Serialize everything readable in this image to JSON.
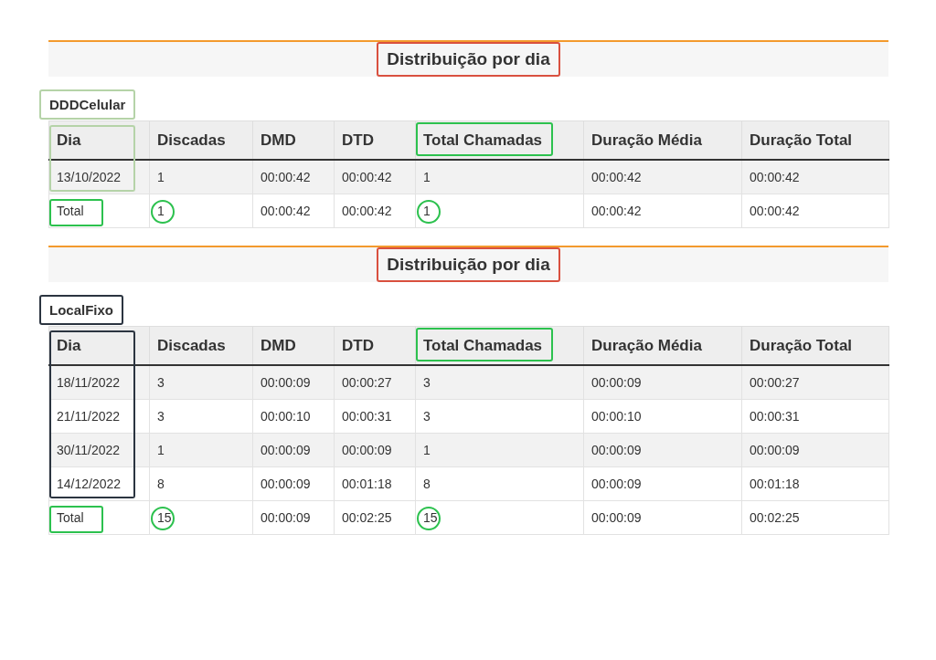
{
  "sections": [
    {
      "title": {
        "text": "Distribuição por dia",
        "color": "#d9503f"
      },
      "label": {
        "text": "DDDCelular",
        "color": "#b5d3a8"
      },
      "columns": [
        {
          "label": "Dia",
          "color": "#b5d3a8"
        },
        {
          "label": "Discadas"
        },
        {
          "label": "DMD"
        },
        {
          "label": "DTD"
        },
        {
          "label": "Total Chamadas",
          "color": "#2cc14e"
        },
        {
          "label": "Duração Média"
        },
        {
          "label": "Duração Total"
        }
      ],
      "rows": [
        [
          "13/10/2022",
          "1",
          "00:00:42",
          "00:00:42",
          "1",
          "00:00:42",
          "00:00:42"
        ]
      ],
      "total": [
        {
          "text": "Total",
          "kind": "box",
          "color": "#2cc14e"
        },
        {
          "text": "1",
          "kind": "circle",
          "color": "#2cc14e"
        },
        {
          "text": "00:00:42"
        },
        {
          "text": "00:00:42"
        },
        {
          "text": "1",
          "kind": "circle",
          "color": "#2cc14e"
        },
        {
          "text": "00:00:42"
        },
        {
          "text": "00:00:42"
        }
      ]
    },
    {
      "title": {
        "text": "Distribuição por dia",
        "color": "#d9503f"
      },
      "label": {
        "text": "LocalFixo",
        "color": "#2b3440"
      },
      "columns": [
        {
          "label": "Dia",
          "color": "#2b3440"
        },
        {
          "label": "Discadas"
        },
        {
          "label": "DMD"
        },
        {
          "label": "DTD"
        },
        {
          "label": "Total Chamadas",
          "color": "#2cc14e"
        },
        {
          "label": "Duração Média"
        },
        {
          "label": "Duração Total"
        }
      ],
      "rows": [
        [
          "18/11/2022",
          "3",
          "00:00:09",
          "00:00:27",
          "3",
          "00:00:09",
          "00:00:27"
        ],
        [
          "21/11/2022",
          "3",
          "00:00:10",
          "00:00:31",
          "3",
          "00:00:10",
          "00:00:31"
        ],
        [
          "30/11/2022",
          "1",
          "00:00:09",
          "00:00:09",
          "1",
          "00:00:09",
          "00:00:09"
        ],
        [
          "14/12/2022",
          "8",
          "00:00:09",
          "00:01:18",
          "8",
          "00:00:09",
          "00:01:18"
        ]
      ],
      "total": [
        {
          "text": "Total",
          "kind": "box",
          "color": "#2cc14e"
        },
        {
          "text": "15",
          "kind": "circle",
          "color": "#2cc14e"
        },
        {
          "text": "00:00:09"
        },
        {
          "text": "00:02:25"
        },
        {
          "text": "15",
          "kind": "circle",
          "color": "#2cc14e"
        },
        {
          "text": "00:00:09"
        },
        {
          "text": "00:02:25"
        }
      ]
    }
  ]
}
